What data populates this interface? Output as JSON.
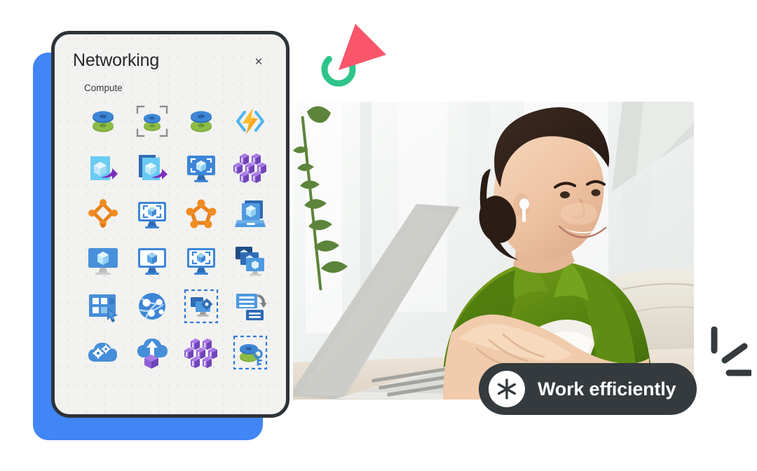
{
  "panel": {
    "title": "Networking",
    "close_label": "×",
    "section_label": "Compute",
    "background_color": "#f2f2f0",
    "border_color": "#2e3338",
    "icons": [
      {
        "name": "virtual-machine-scale-set-icon",
        "style": "disc-stack",
        "row": 1,
        "col": 1
      },
      {
        "name": "vm-scale-set-selected-icon",
        "style": "disc-stack-bracket",
        "row": 1,
        "col": 2
      },
      {
        "name": "virtual-machine-disc-icon",
        "style": "disc-stack",
        "row": 1,
        "col": 3
      },
      {
        "name": "azure-functions-icon",
        "style": "function-bolt",
        "row": 1,
        "col": 4
      },
      {
        "name": "vm-image-export-icon",
        "style": "image-arrow",
        "row": 2,
        "col": 1
      },
      {
        "name": "vm-images-export-icon",
        "style": "images-arrow",
        "row": 2,
        "col": 2
      },
      {
        "name": "virtual-desktop-selected-icon",
        "style": "monitor-bracket",
        "row": 2,
        "col": 3
      },
      {
        "name": "server-cluster-icon",
        "style": "server-cluster",
        "row": 2,
        "col": 4
      },
      {
        "name": "availability-set-icon",
        "style": "orange-diamond",
        "row": 3,
        "col": 1
      },
      {
        "name": "vm-monitor-bracket-icon",
        "style": "screen-bracket",
        "row": 3,
        "col": 2
      },
      {
        "name": "service-fabric-cluster-icon",
        "style": "orange-pentagon",
        "row": 3,
        "col": 3
      },
      {
        "name": "vm-image-gallery-icon",
        "style": "laptop-cube",
        "row": 3,
        "col": 4
      },
      {
        "name": "virtual-machine-icon",
        "style": "monitor-filled",
        "row": 4,
        "col": 1
      },
      {
        "name": "virtual-machine-white-icon",
        "style": "monitor-white",
        "row": 4,
        "col": 2
      },
      {
        "name": "virtual-machine-selected-icon",
        "style": "screen-bracket",
        "row": 4,
        "col": 3
      },
      {
        "name": "virtual-machine-stack-icon",
        "style": "monitor-stack",
        "row": 4,
        "col": 4
      },
      {
        "name": "dashboard-select-icon",
        "style": "dashboard-cursor",
        "row": 5,
        "col": 1
      },
      {
        "name": "virtual-network-globe-icon",
        "style": "network-globe",
        "row": 5,
        "col": 2
      },
      {
        "name": "vm-settings-selected-icon",
        "style": "monitor-gear-dash",
        "row": 5,
        "col": 3
      },
      {
        "name": "batch-accounts-icon",
        "style": "list-sync",
        "row": 5,
        "col": 4
      },
      {
        "name": "cloud-services-icon",
        "style": "cloud-gears",
        "row": 6,
        "col": 1
      },
      {
        "name": "cloud-upload-icon",
        "style": "cloud-upload",
        "row": 6,
        "col": 2
      },
      {
        "name": "server-farm-icon",
        "style": "server-cluster",
        "row": 6,
        "col": 3
      },
      {
        "name": "disk-access-key-icon",
        "style": "disc-key-dash",
        "row": 6,
        "col": 4
      }
    ]
  },
  "badge": {
    "text": "Work efficiently",
    "icon": "asterisk-icon",
    "background_color": "#343a3d",
    "text_color": "#ffffff"
  },
  "decorations": {
    "cursor_arrow": {
      "name": "pink-cursor-arrow",
      "color": "#f9556b"
    },
    "loading_ring": {
      "name": "green-progress-ring",
      "color": "#2ec48a"
    },
    "accent_lines": {
      "name": "sparkle-lines",
      "color": "#343a3d"
    },
    "blue_card": {
      "name": "blue-backdrop-card",
      "color": "#4285f4"
    }
  },
  "photo": {
    "name": "woman-working-on-laptop-photo",
    "alt": "Smiling woman with earbuds working on a laptop in a bright office"
  }
}
